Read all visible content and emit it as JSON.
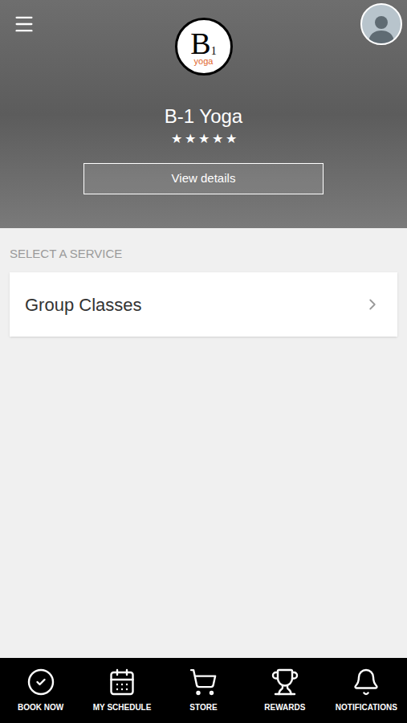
{
  "header": {
    "logo": {
      "letter": "B",
      "number": "1",
      "word": "yoga"
    },
    "title": "B-1 Yoga",
    "stars": 5,
    "max_stars": 5,
    "details_button": "View details"
  },
  "section_label": "SELECT A SERVICE",
  "services": [
    {
      "label": "Group Classes"
    }
  ],
  "bottom_nav": [
    {
      "label": "BOOK NOW",
      "kind": "book"
    },
    {
      "label": "MY SCHEDULE",
      "kind": "schedule"
    },
    {
      "label": "STORE",
      "kind": "store"
    },
    {
      "label": "REWARDS",
      "kind": "rewards"
    },
    {
      "label": "NOTIFICATIONS",
      "kind": "notifications"
    }
  ]
}
